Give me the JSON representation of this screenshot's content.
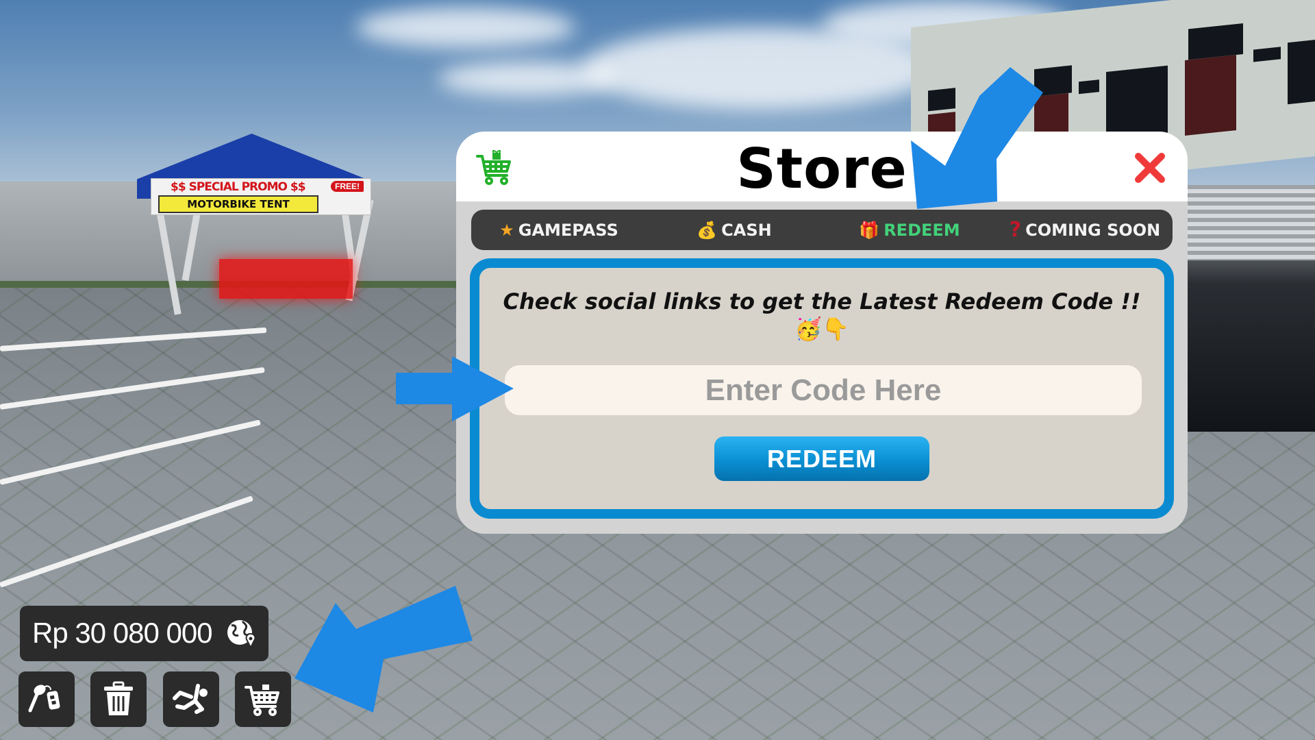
{
  "scene": {
    "tent_sign": {
      "promo": "$$ SPECIAL PROMO $$",
      "free_badge": "FREE!",
      "name": "MOTORBIKE TENT"
    }
  },
  "store": {
    "title": "Store",
    "store_icon": "shopping-cart-gift-icon",
    "close_icon": "close-x-icon",
    "tabs": [
      {
        "icon": "★",
        "icon_name": "star-icon",
        "label": "GAMEPASS",
        "active": false
      },
      {
        "icon": "💰",
        "icon_name": "money-bag-icon",
        "label": "CASH",
        "active": false
      },
      {
        "icon": "🎁",
        "icon_name": "gift-icon",
        "label": "REDEEM",
        "active": true
      },
      {
        "icon": "?",
        "icon_name": "question-mark-icon",
        "label": "COMING SOON",
        "active": false
      }
    ],
    "redeem": {
      "message": "Check social links to get the Latest Redeem Code !!",
      "emoji": "🥳👇",
      "input_value": "",
      "input_placeholder": "Enter Code Here",
      "button_label": "REDEEM"
    },
    "colors": {
      "active_tab": "#43d17a",
      "panel_border": "#0a8bd1",
      "close": "#f03a3a",
      "store_icon": "#22b02a"
    }
  },
  "hud": {
    "money": "Rp 30 080 000",
    "map_icon": "globe-location-icon",
    "buttons": [
      {
        "name": "car-keys-button",
        "icon": "car-keys-icon"
      },
      {
        "name": "delete-button",
        "icon": "trash-icon"
      },
      {
        "name": "ragdoll-button",
        "icon": "falling-person-icon"
      },
      {
        "name": "store-button",
        "icon": "shopping-cart-icon"
      }
    ]
  },
  "annotations": {
    "arrow_color": "#1e88e5",
    "arrows": [
      "pointing-to-redeem-tab",
      "pointing-to-code-input",
      "pointing-to-store-button"
    ]
  }
}
